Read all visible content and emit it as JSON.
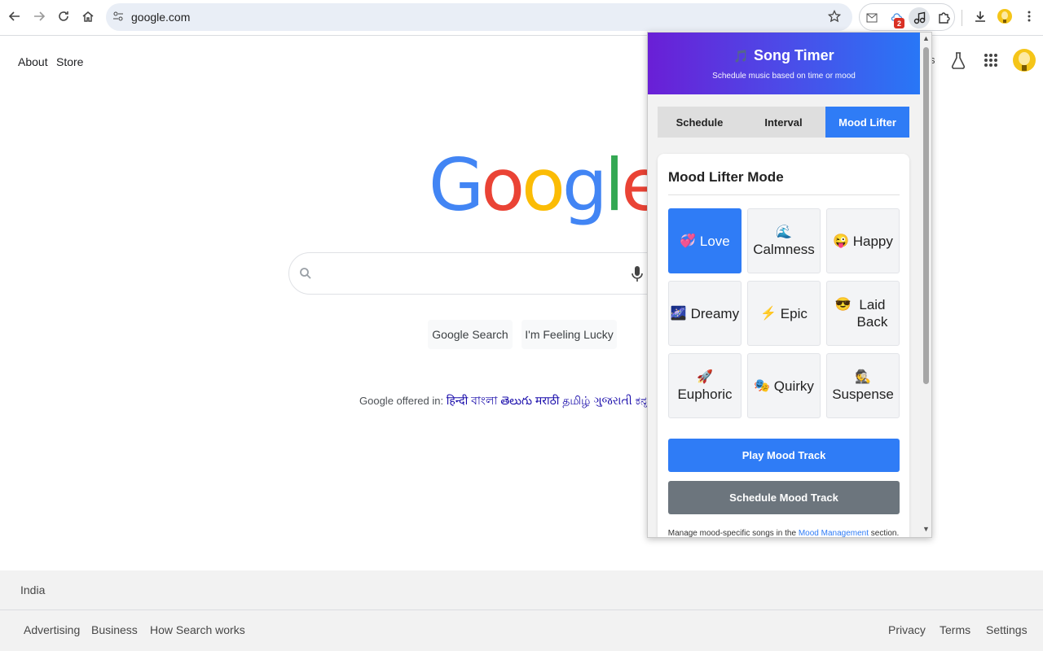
{
  "browser": {
    "url": "google.com",
    "extension_badge": "2"
  },
  "google": {
    "top_links": [
      "About",
      "Store"
    ],
    "logo_letters": [
      {
        "char": "G",
        "color": "#4285F4"
      },
      {
        "char": "o",
        "color": "#EA4335"
      },
      {
        "char": "o",
        "color": "#FBBC05"
      },
      {
        "char": "g",
        "color": "#4285F4"
      },
      {
        "char": "l",
        "color": "#34A853"
      },
      {
        "char": "e",
        "color": "#EA4335"
      }
    ],
    "search_button": "Google Search",
    "lucky_button": "I'm Feeling Lucky",
    "offered_label": "Google offered in:",
    "offered_langs": "हिन्दी বাংলা తెలుగు मराठी தமிழ் ગુજરાતી ಕನ್ನಡ മലയാ",
    "country": "India",
    "footer_left": [
      "Advertising",
      "Business",
      "How Search works"
    ],
    "footer_right": [
      "Privacy",
      "Terms",
      "Settings"
    ],
    "partial_text": "s"
  },
  "popup": {
    "title": "Song Timer",
    "title_icon": "🎵",
    "subtitle": "Schedule music based on time or mood",
    "tabs": [
      "Schedule",
      "Interval",
      "Mood Lifter"
    ],
    "active_tab": "Mood Lifter",
    "section_title": "Mood Lifter Mode",
    "moods": [
      {
        "emoji": "💞",
        "label": "Love",
        "active": true
      },
      {
        "emoji": "🌊",
        "label": "Calmness",
        "active": false
      },
      {
        "emoji": "😜",
        "label": "Happy",
        "active": false
      },
      {
        "emoji": "🌌",
        "label": "Dreamy",
        "active": false
      },
      {
        "emoji": "⚡",
        "label": "Epic",
        "active": false
      },
      {
        "emoji": "😎",
        "label": "Laid Back",
        "active": false
      },
      {
        "emoji": "🚀",
        "label": "Euphoric",
        "active": false
      },
      {
        "emoji": "🎭",
        "label": "Quirky",
        "active": false
      },
      {
        "emoji": "🕵",
        "label": "Suspense",
        "active": false
      }
    ],
    "play_button": "Play Mood Track",
    "schedule_button": "Schedule Mood Track",
    "note_prefix": "Manage mood-specific songs in the",
    "note_link": "Mood Management",
    "note_suffix": "section.",
    "colors": {
      "accent": "#2f7cf6",
      "secondary_button": "#6c757d"
    }
  }
}
